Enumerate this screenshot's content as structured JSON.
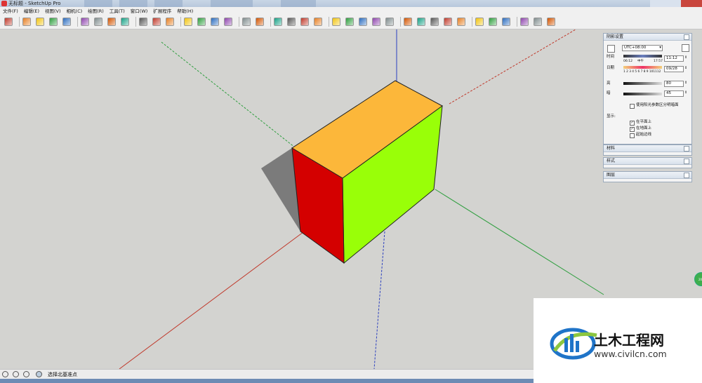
{
  "window": {
    "title": "无标题 - SketchUp Pro"
  },
  "menu": [
    "文件(F)",
    "编辑(E)",
    "视图(V)",
    "相机(C)",
    "绘图(R)",
    "工具(T)",
    "窗口(W)",
    "扩展程序",
    "帮助(H)"
  ],
  "toolbar": {
    "icons": [
      "select-icon",
      "eraser-icon",
      "pencil-icon",
      "arc-icon",
      "rectangle-icon",
      "push-pull-icon",
      "move-icon",
      "rotate-icon",
      "scale-icon",
      "tape-measure-icon",
      "text-icon",
      "paint-bucket-icon",
      "orbit-icon",
      "pan-icon",
      "zoom-icon",
      "zoom-extents-icon",
      "components-icon",
      "section-icon",
      "styles-icon",
      "shadows-icon",
      "xray-icon",
      "wireframe-icon",
      "hidden-line-icon",
      "shaded-icon",
      "textured-icon",
      "monochrome-icon",
      "sandbox-icon",
      "drape-icon",
      "smoove-icon",
      "stamp-icon",
      "flip-edge-icon",
      "add-detail-icon",
      "solid-union-icon",
      "solid-subtract-icon",
      "solid-trim-icon",
      "warehouse-icon",
      "extension-icon",
      "ruby-icon"
    ]
  },
  "shadow_panel": {
    "title": "阴影设置",
    "timezone": "UTC+08:00",
    "time_label": "时间",
    "time_start": "06:12",
    "time_mid": "中午",
    "time_end": "17:57",
    "time_value": "11:12",
    "date_label": "日期",
    "date_months": "1 2 3 4 5 6 7 8 9 101112",
    "date_value": "09/28",
    "light_label": "亮",
    "light_value": "80",
    "dark_label": "暗",
    "dark_value": "45",
    "use_sun_label": "使用阳光参数区分明暗面",
    "use_sun_checked": false,
    "display_label": "显示:",
    "on_faces_label": "在平面上",
    "on_faces_checked": true,
    "on_ground_label": "在地面上",
    "on_ground_checked": true,
    "from_edges_label": "起始边线",
    "from_edges_checked": false
  },
  "trays": [
    "材料",
    "样式",
    "图层"
  ],
  "status": {
    "text": "选择北基准点"
  },
  "watermark": {
    "name": "土木工程网",
    "url": "www.civilcn.com"
  },
  "scene": {
    "top_face_color": "#fcb73a",
    "front_face_color": "#99ff08",
    "left_face_color": "#d40000",
    "shadow_color": "#7b7b7b",
    "axis_red": "#c0392b",
    "axis_green": "#2e9e3e",
    "axis_blue": "#2b3fbf"
  },
  "hint_badge": "20%"
}
